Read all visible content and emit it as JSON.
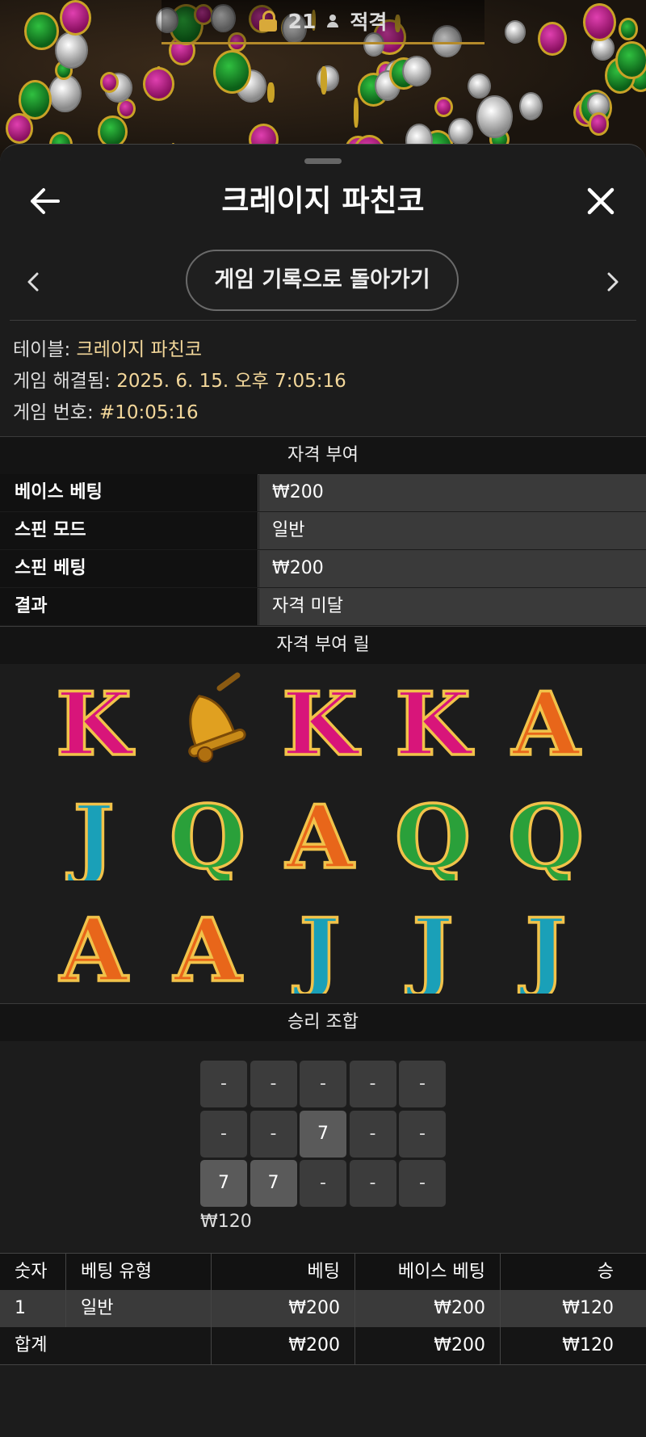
{
  "top_bar": {
    "count": "21",
    "qualify_label": "적격"
  },
  "header": {
    "title": "크레이지 파친코"
  },
  "nav": {
    "back_to_history": "게임 기록으로 돌아가기"
  },
  "info": {
    "table_label": "테이블:",
    "table_value": "크레이지 파친코",
    "resolved_label": "게임 해결됨:",
    "resolved_value": "2025. 6. 15. 오후 7:05:16",
    "game_no_label": "게임 번호:",
    "game_no_value": "#10:05:16"
  },
  "qualification": {
    "heading": "자격 부여",
    "rows": [
      {
        "key": "베이스 베팅",
        "value": "₩200"
      },
      {
        "key": "스핀 모드",
        "value": "일반"
      },
      {
        "key": "스핀 베팅",
        "value": "₩200"
      },
      {
        "key": "결과",
        "value": "자격 미달"
      }
    ]
  },
  "reels": {
    "heading": "자격 부여 릴",
    "rows": [
      [
        "K",
        "bell",
        "K",
        "K",
        "A"
      ],
      [
        "J",
        "Q",
        "A",
        "Q",
        "Q"
      ],
      [
        "A",
        "A",
        "J",
        "J",
        "J"
      ]
    ],
    "colors": {
      "K": "#d8157a",
      "A": "#e8661a",
      "J": "#1aa0b8",
      "Q": "#2aa03a",
      "bell": "#e0a020",
      "outline": "#f1c24a"
    }
  },
  "wins": {
    "heading": "승리 조합",
    "grid": [
      [
        "-",
        "-",
        "-",
        "-",
        "-"
      ],
      [
        "-",
        "-",
        "7",
        "-",
        "-"
      ],
      [
        "7",
        "7",
        "-",
        "-",
        "-"
      ]
    ],
    "amount": "₩120"
  },
  "bets_table": {
    "headers": [
      "숫자",
      "베팅 유형",
      "베팅",
      "베이스 베팅",
      "승"
    ],
    "rows": [
      {
        "num": "1",
        "type": "일반",
        "bet": "₩200",
        "base": "₩200",
        "win": "₩120"
      }
    ],
    "total": {
      "label": "합계",
      "bet": "₩200",
      "base": "₩200",
      "win": "₩120"
    }
  }
}
